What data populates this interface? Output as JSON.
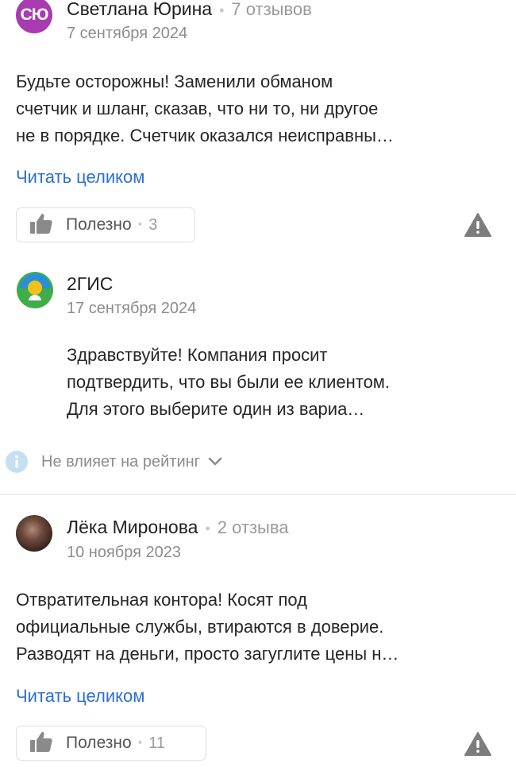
{
  "reviews": [
    {
      "avatar_initials": "СЮ",
      "author": "Светлана Юрина",
      "reviews_count": "7 отзывов",
      "date": "7 сентября 2024",
      "text_lines": [
        "Будьте осторожны! Заменили обманом",
        "счетчик и шланг, сказав, что ни то, ни другое",
        "не в порядке. Счетчик оказался неисправны…"
      ],
      "read_more": "Читать целиком",
      "useful_label": "Полезно",
      "useful_count": "3"
    },
    {
      "avatar_initials": "",
      "author": "Лёка Миронова",
      "reviews_count": "2 отзыва",
      "date": "10 ноября 2023",
      "text_lines": [
        "Отвратительная контора! Косят под",
        "официальные службы, втираются в доверие.",
        "Разводят на деньги, просто загуглите цены н…"
      ],
      "read_more": "Читать целиком",
      "useful_label": "Полезно",
      "useful_count": "11"
    }
  ],
  "reply": {
    "author": "2ГИС",
    "date": "17 сентября 2024",
    "text_lines": [
      "Здравствуйте! Компания просит",
      "подтвердить, что вы были ее клиентом.",
      "Для этого выберите один из вариа…"
    ],
    "no_rating_label": "Не влияет на рейтинг"
  },
  "colors": {
    "accent_link": "#2b6fd6",
    "avatar_su": "#a93bb0",
    "logo_green": "#3fae49",
    "logo_blue": "#2a8fd8"
  },
  "icons": [
    "thumb-up-icon",
    "warning-icon",
    "info-icon",
    "chevron-down-icon",
    "2gis-logo-icon"
  ]
}
